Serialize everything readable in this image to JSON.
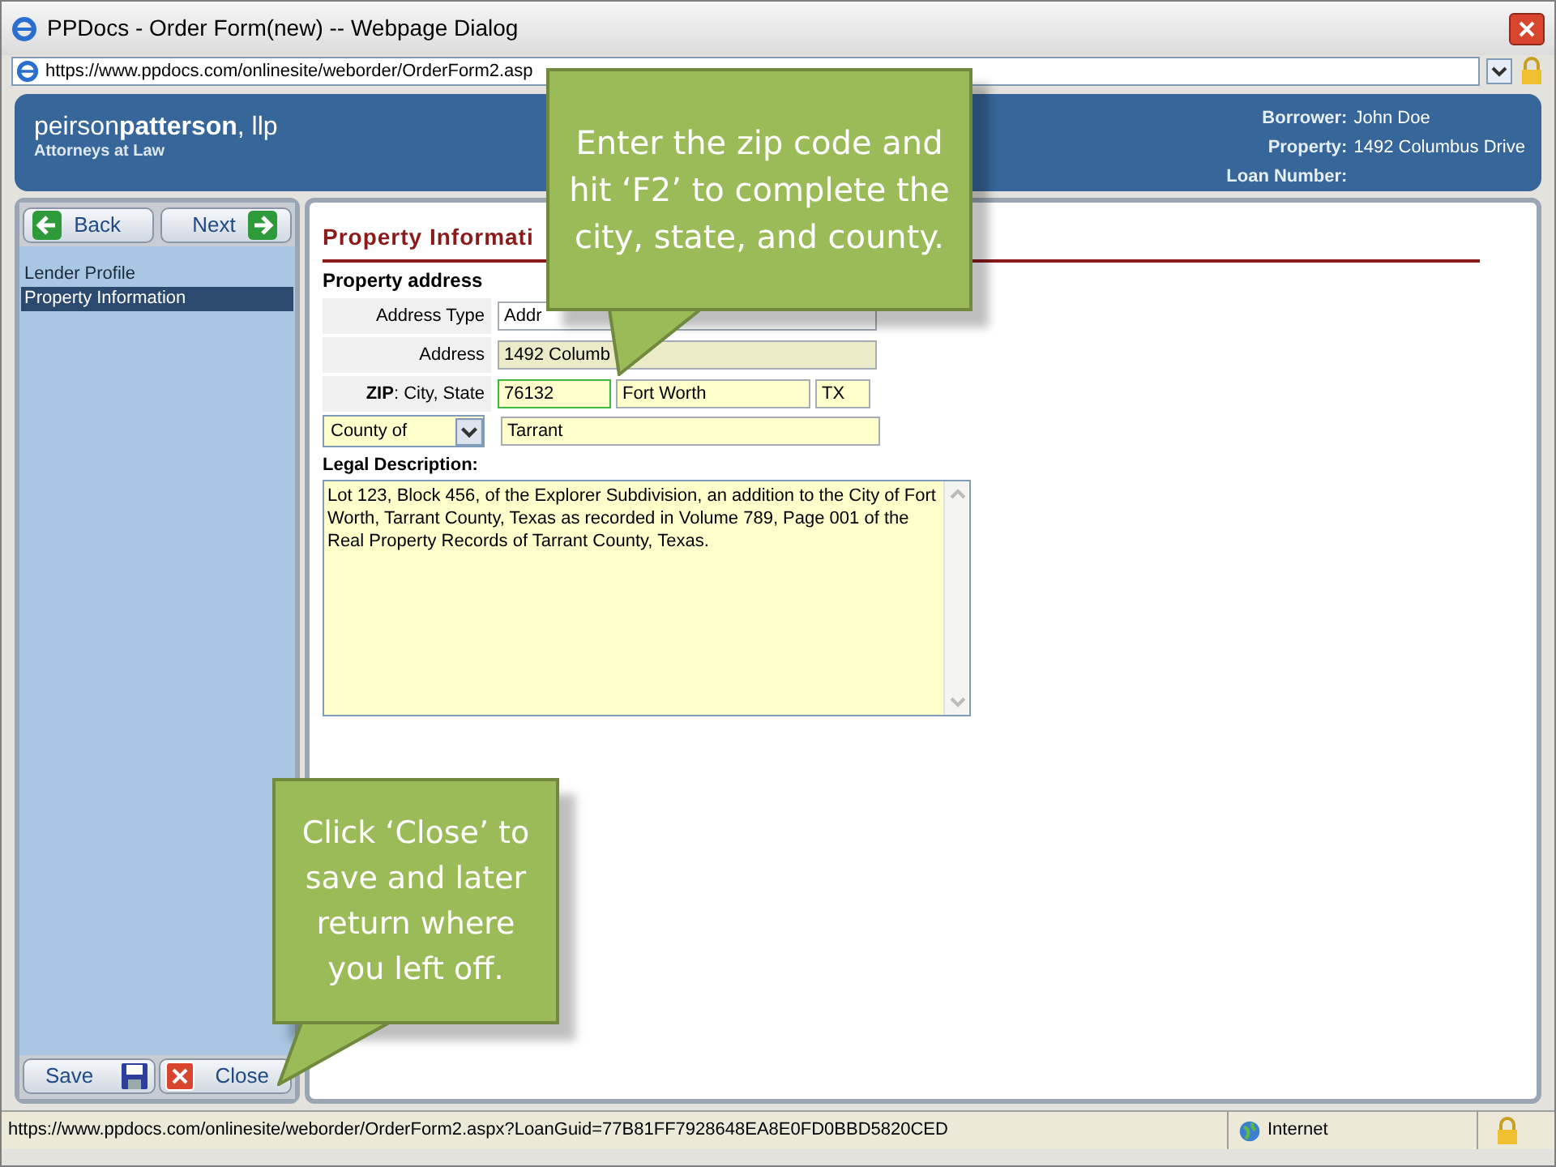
{
  "window": {
    "title": "PPDocs - Order Form(new) -- Webpage Dialog"
  },
  "address_bar": {
    "url": "https://www.ppdocs.com/onlinesite/weborder/OrderForm2.asp"
  },
  "header": {
    "logo_light": "peirson",
    "logo_bold": "patterson",
    "logo_suffix": ", llp",
    "tagline": "Attorneys at Law",
    "info": [
      {
        "label": "Borrower:",
        "value": "John Doe"
      },
      {
        "label": "Property:",
        "value": "1492 Columbus Drive"
      },
      {
        "label": "Loan Number:"
      }
    ]
  },
  "nav": {
    "buttons": [
      {
        "label": "Back",
        "kind": "back"
      },
      {
        "label": "Next",
        "kind": "next"
      }
    ],
    "items": [
      {
        "label": "Lender Profile",
        "selected": false
      },
      {
        "label": "Property Information",
        "selected": true
      }
    ],
    "footer_buttons": [
      {
        "label": "Save",
        "kind": "save"
      },
      {
        "label": "Close",
        "kind": "close"
      }
    ]
  },
  "form": {
    "section_title": "Property Informati",
    "subheading": "Property address",
    "rows": [
      {
        "label": "Address Type",
        "fields": [
          {
            "value": "Addr",
            "kind": "plain",
            "focused": false
          }
        ]
      },
      {
        "label": "Address",
        "fields": [
          {
            "value": "1492 Columb",
            "kind": "wide",
            "focused": false
          }
        ]
      },
      {
        "label": "**ZIP**: City, State",
        "fields": [
          {
            "value": "76132",
            "kind": "zip",
            "focused": true
          },
          {
            "value": "Fort Worth",
            "kind": "city",
            "focused": false
          },
          {
            "value": "TX",
            "kind": "state",
            "focused": false
          }
        ]
      }
    ],
    "county": {
      "select": "County of",
      "value": "Tarrant"
    },
    "legal_label": "Legal Description:",
    "legal_text": "Lot 123, Block 456, of the Explorer Subdivision, an addition to the City of Fort Worth, Tarrant County, Texas as recorded in Volume 789, Page 001 of the Real Property Records of Tarrant County, Texas."
  },
  "status_bar": {
    "url": "https://www.ppdocs.com/onlinesite/weborder/OrderForm2.aspx?LoanGuid=77B81FF7928648EA8E0FD0BBD5820CED",
    "zone": "Internet"
  },
  "callouts": [
    {
      "text": "Enter the zip code and hit ‘F2’ to complete the city, state, and county."
    },
    {
      "text": "Click ‘Close’ to save and later return where you left off."
    }
  ]
}
